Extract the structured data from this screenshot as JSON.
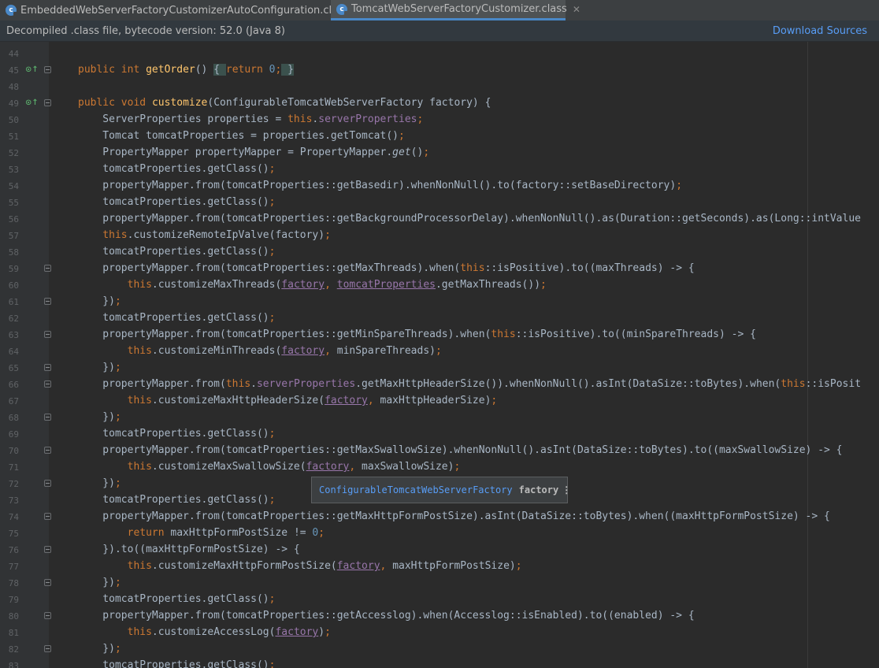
{
  "tabs": [
    {
      "label": "EmbeddedWebServerFactoryCustomizerAutoConfiguration.class",
      "icon": "class-file-icon",
      "active": false
    },
    {
      "label": "TomcatWebServerFactoryCustomizer.class",
      "icon": "class-file-icon",
      "active": true
    }
  ],
  "infobar": {
    "message": "Decompiled .class file, bytecode version: 52.0 (Java 8)",
    "download_label": "Download Sources"
  },
  "colors": {
    "keyword": "#cc7832",
    "method": "#ffc66d",
    "field": "#9876aa",
    "number": "#6897bb",
    "text": "#a9b7c6",
    "link": "#589df6",
    "background": "#2b2b2b"
  },
  "tooltip": {
    "type": "ConfigurableTomcatWebServerFactory",
    "param": "factory",
    "more": "⋮"
  },
  "code_lines": [
    {
      "n": "44",
      "tokens": []
    },
    {
      "n": "45",
      "ov": true,
      "fold": true,
      "tokens": [
        [
          "k",
          "public "
        ],
        [
          "k",
          "int "
        ],
        [
          "m",
          "getOrder"
        ],
        [
          "",
          "() "
        ],
        [
          "lb",
          "{ "
        ],
        [
          "k",
          "return "
        ],
        [
          "n",
          "0"
        ],
        [
          "k",
          ";"
        ],
        [
          "lb",
          " }"
        ]
      ]
    },
    {
      "n": "48",
      "tokens": []
    },
    {
      "n": "49",
      "ov": true,
      "fold": true,
      "tokens": [
        [
          "k",
          "public "
        ],
        [
          "k",
          "void "
        ],
        [
          "m",
          "customize"
        ],
        [
          "",
          "(ConfigurableTomcatWebServerFactory factory) {"
        ]
      ]
    },
    {
      "n": "50",
      "tokens": [
        [
          "",
          "    ServerProperties properties = "
        ],
        [
          "k",
          "this"
        ],
        [
          "",
          "."
        ],
        [
          "f",
          "serverProperties"
        ],
        [
          "k",
          ";"
        ]
      ]
    },
    {
      "n": "51",
      "tokens": [
        [
          "",
          "    Tomcat tomcatProperties = properties.getTomcat()"
        ],
        [
          "k",
          ";"
        ]
      ]
    },
    {
      "n": "52",
      "tokens": [
        [
          "",
          "    PropertyMapper propertyMapper = PropertyMapper."
        ],
        [
          "i",
          "get"
        ],
        [
          "",
          "()"
        ],
        [
          "k",
          ";"
        ]
      ]
    },
    {
      "n": "53",
      "tokens": [
        [
          "",
          "    tomcatProperties.getClass()"
        ],
        [
          "k",
          ";"
        ]
      ]
    },
    {
      "n": "54",
      "tokens": [
        [
          "",
          "    propertyMapper.from(tomcatProperties::getBasedir).whenNonNull().to(factory::setBaseDirectory)"
        ],
        [
          "k",
          ";"
        ]
      ]
    },
    {
      "n": "55",
      "tokens": [
        [
          "",
          "    tomcatProperties.getClass()"
        ],
        [
          "k",
          ";"
        ]
      ]
    },
    {
      "n": "56",
      "tokens": [
        [
          "",
          "    propertyMapper.from(tomcatProperties::getBackgroundProcessorDelay).whenNonNull().as(Duration::getSeconds).as(Long::intValue"
        ]
      ]
    },
    {
      "n": "57",
      "tokens": [
        [
          "k",
          "    this"
        ],
        [
          "",
          ".customizeRemoteIpValve(factory)"
        ],
        [
          "k",
          ";"
        ]
      ]
    },
    {
      "n": "58",
      "tokens": [
        [
          "",
          "    tomcatProperties.getClass()"
        ],
        [
          "k",
          ";"
        ]
      ]
    },
    {
      "n": "59",
      "fold": true,
      "tokens": [
        [
          "",
          "    propertyMapper.from(tomcatProperties::getMaxThreads).when("
        ],
        [
          "k",
          "this"
        ],
        [
          "",
          "::isPositive).to((maxThreads) -> {"
        ]
      ]
    },
    {
      "n": "60",
      "tokens": [
        [
          "k",
          "        this"
        ],
        [
          "",
          ".customizeMaxThreads("
        ],
        [
          "u",
          "factory"
        ],
        [
          "k",
          ", "
        ],
        [
          "u",
          "tomcatProperties"
        ],
        [
          "",
          ".getMaxThreads())"
        ],
        [
          "k",
          ";"
        ]
      ]
    },
    {
      "n": "61",
      "fold": true,
      "tokens": [
        [
          "",
          "    })"
        ],
        [
          "k",
          ";"
        ]
      ]
    },
    {
      "n": "62",
      "tokens": [
        [
          "",
          "    tomcatProperties.getClass()"
        ],
        [
          "k",
          ";"
        ]
      ]
    },
    {
      "n": "63",
      "fold": true,
      "tokens": [
        [
          "",
          "    propertyMapper.from(tomcatProperties::getMinSpareThreads).when("
        ],
        [
          "k",
          "this"
        ],
        [
          "",
          "::isPositive).to((minSpareThreads) -> {"
        ]
      ]
    },
    {
      "n": "64",
      "tokens": [
        [
          "k",
          "        this"
        ],
        [
          "",
          ".customizeMinThreads("
        ],
        [
          "u",
          "factory"
        ],
        [
          "k",
          ", "
        ],
        [
          "",
          "minSpareThreads)"
        ],
        [
          "k",
          ";"
        ]
      ]
    },
    {
      "n": "65",
      "fold": true,
      "tokens": [
        [
          "",
          "    })"
        ],
        [
          "k",
          ";"
        ]
      ]
    },
    {
      "n": "66",
      "fold": true,
      "tokens": [
        [
          "",
          "    propertyMapper.from("
        ],
        [
          "k",
          "this"
        ],
        [
          "",
          "."
        ],
        [
          "f",
          "serverProperties"
        ],
        [
          "",
          ".getMaxHttpHeaderSize()).whenNonNull().asInt(DataSize::toBytes).when("
        ],
        [
          "k",
          "this"
        ],
        [
          "",
          "::isPosit"
        ]
      ]
    },
    {
      "n": "67",
      "tokens": [
        [
          "k",
          "        this"
        ],
        [
          "",
          ".customizeMaxHttpHeaderSize("
        ],
        [
          "u",
          "factory"
        ],
        [
          "k",
          ", "
        ],
        [
          "",
          "maxHttpHeaderSize)"
        ],
        [
          "k",
          ";"
        ]
      ]
    },
    {
      "n": "68",
      "fold": true,
      "tokens": [
        [
          "",
          "    })"
        ],
        [
          "k",
          ";"
        ]
      ]
    },
    {
      "n": "69",
      "tokens": [
        [
          "",
          "    tomcatProperties.getClass()"
        ],
        [
          "k",
          ";"
        ]
      ]
    },
    {
      "n": "70",
      "fold": true,
      "tokens": [
        [
          "",
          "    propertyMapper.from(tomcatProperties::getMaxSwallowSize).whenNonNull().asInt(DataSize::toBytes).to((maxSwallowSize) -> {"
        ]
      ]
    },
    {
      "n": "71",
      "tokens": [
        [
          "k",
          "        this"
        ],
        [
          "",
          ".customizeMaxSwallowSize("
        ],
        [
          "u",
          "factory"
        ],
        [
          "k",
          ", "
        ],
        [
          "",
          "maxSwallowSize)"
        ],
        [
          "k",
          ";"
        ]
      ]
    },
    {
      "n": "72",
      "fold": true,
      "tokens": [
        [
          "",
          "    })"
        ],
        [
          "k",
          ";"
        ]
      ]
    },
    {
      "n": "73",
      "tokens": [
        [
          "",
          "    tomcatProperties.getClass()"
        ],
        [
          "k",
          ";"
        ]
      ]
    },
    {
      "n": "74",
      "fold": true,
      "tokens": [
        [
          "",
          "    propertyMapper.from(tomcatProperties::getMaxHttpFormPostSize).asInt(DataSize::toBytes).when((maxHttpFormPostSize) -> {"
        ]
      ]
    },
    {
      "n": "75",
      "tokens": [
        [
          "k",
          "        return "
        ],
        [
          "",
          "maxHttpFormPostSize != "
        ],
        [
          "n",
          "0"
        ],
        [
          "k",
          ";"
        ]
      ]
    },
    {
      "n": "76",
      "fold": true,
      "tokens": [
        [
          "",
          "    }).to((maxHttpFormPostSize) -> {"
        ]
      ]
    },
    {
      "n": "77",
      "tokens": [
        [
          "k",
          "        this"
        ],
        [
          "",
          ".customizeMaxHttpFormPostSize("
        ],
        [
          "u",
          "factory"
        ],
        [
          "k",
          ", "
        ],
        [
          "",
          "maxHttpFormPostSize)"
        ],
        [
          "k",
          ";"
        ]
      ]
    },
    {
      "n": "78",
      "fold": true,
      "tokens": [
        [
          "",
          "    })"
        ],
        [
          "k",
          ";"
        ]
      ]
    },
    {
      "n": "79",
      "tokens": [
        [
          "",
          "    tomcatProperties.getClass()"
        ],
        [
          "k",
          ";"
        ]
      ]
    },
    {
      "n": "80",
      "fold": true,
      "tokens": [
        [
          "",
          "    propertyMapper.from(tomcatProperties::getAccesslog).when(Accesslog::isEnabled).to((enabled) -> {"
        ]
      ]
    },
    {
      "n": "81",
      "tokens": [
        [
          "k",
          "        this"
        ],
        [
          "",
          ".customizeAccessLog("
        ],
        [
          "u",
          "factory"
        ],
        [
          "",
          ")"
        ],
        [
          "k",
          ";"
        ]
      ]
    },
    {
      "n": "82",
      "fold": true,
      "tokens": [
        [
          "",
          "    })"
        ],
        [
          "k",
          ";"
        ]
      ]
    },
    {
      "n": "83",
      "tokens": [
        [
          "",
          "    tomcatProperties.getClass()"
        ],
        [
          "k",
          ";"
        ]
      ]
    }
  ]
}
